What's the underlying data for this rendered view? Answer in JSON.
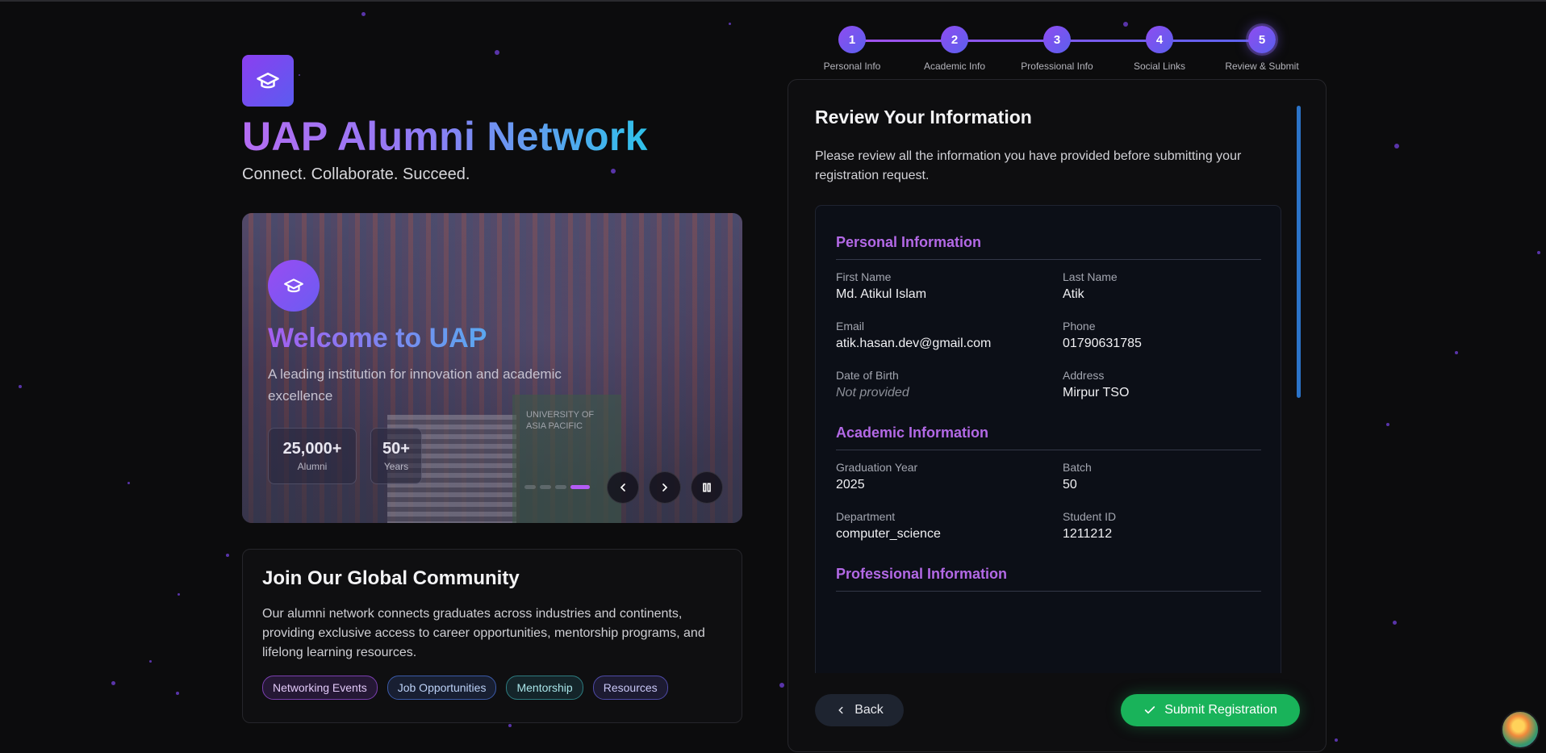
{
  "brand": {
    "title": "UAP Alumni Network",
    "tagline": "Connect. Collaborate. Succeed.",
    "logo_icon": "graduation-cap-icon"
  },
  "hero": {
    "title": "Welcome to UAP",
    "subtitle": "A leading institution for innovation and academic excellence",
    "sign_text": "UNIVERSITY OF ASIA PACIFIC",
    "stats": [
      {
        "value": "25,000+",
        "label": "Alumni"
      },
      {
        "value": "50+",
        "label": "Years"
      }
    ],
    "slide_count": 4,
    "active_slide": 4,
    "controls": {
      "prev_icon": "chevron-left-icon",
      "next_icon": "chevron-right-icon",
      "pause_icon": "pause-icon"
    }
  },
  "community": {
    "title": "Join Our Global Community",
    "body": "Our alumni network connects graduates across industries and continents, providing exclusive access to career opportunities, mentorship programs, and lifelong learning resources.",
    "tags": [
      "Networking Events",
      "Job Opportunities",
      "Mentorship",
      "Resources"
    ]
  },
  "stepper": {
    "current_step": 5,
    "steps": [
      {
        "number": "1",
        "label": "Personal Info"
      },
      {
        "number": "2",
        "label": "Academic Info"
      },
      {
        "number": "3",
        "label": "Professional Info"
      },
      {
        "number": "4",
        "label": "Social Links"
      },
      {
        "number": "5",
        "label": "Review & Submit"
      }
    ]
  },
  "review": {
    "title": "Review Your Information",
    "intro": "Please review all the information you have provided before submitting your registration request.",
    "personal": {
      "title": "Personal Information",
      "first_name_label": "First Name",
      "first_name": "Md. Atikul Islam",
      "last_name_label": "Last Name",
      "last_name": "Atik",
      "email_label": "Email",
      "email": "atik.hasan.dev@gmail.com",
      "phone_label": "Phone",
      "phone": "01790631785",
      "dob_label": "Date of Birth",
      "dob": "Not provided",
      "address_label": "Address",
      "address": "Mirpur TSO"
    },
    "academic": {
      "title": "Academic Information",
      "grad_year_label": "Graduation Year",
      "grad_year": "2025",
      "batch_label": "Batch",
      "batch": "50",
      "department_label": "Department",
      "department": "computer_science",
      "student_id_label": "Student ID",
      "student_id": "1211212"
    },
    "professional": {
      "title": "Professional Information"
    }
  },
  "actions": {
    "back_label": "Back",
    "submit_label": "Submit Registration"
  },
  "colors": {
    "accent_purple": "#b369e6",
    "accent_blue": "#2fc2ea",
    "submit_green": "#19b35a",
    "background": "#0c0c0d"
  }
}
